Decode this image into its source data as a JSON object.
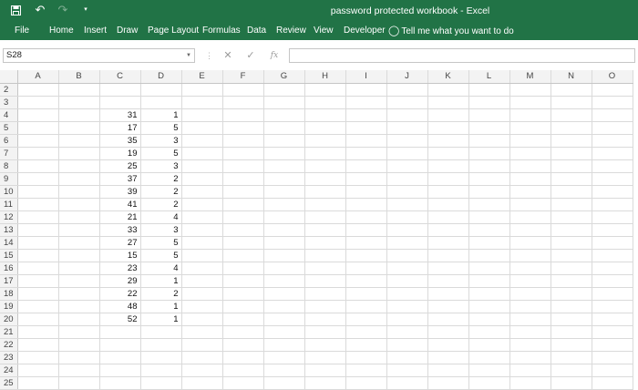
{
  "titlebar": {
    "title": "password protected workbook  -  Excel",
    "save_icon": "save-icon",
    "undo_icon": "undo-icon",
    "redo_icon": "redo-icon",
    "customize_icon": "customize-qat-icon"
  },
  "ribbon": {
    "tabs": [
      "File",
      "Home",
      "Insert",
      "Draw",
      "Page Layout",
      "Formulas",
      "Data",
      "Review",
      "View",
      "Developer"
    ],
    "tell_me": "Tell me what you want to do",
    "tell_me_icon": "lightbulb-icon"
  },
  "formula_bar": {
    "name_box": "S28",
    "formula": "",
    "fx_label": "fx"
  },
  "grid": {
    "columns": [
      "A",
      "B",
      "C",
      "D",
      "E",
      "F",
      "G",
      "H",
      "I",
      "J",
      "K",
      "L",
      "M",
      "N",
      "O"
    ],
    "rows": [
      {
        "num": "2",
        "c": "",
        "d": ""
      },
      {
        "num": "3",
        "c": "",
        "d": ""
      },
      {
        "num": "4",
        "c": "31",
        "d": "1"
      },
      {
        "num": "5",
        "c": "17",
        "d": "5"
      },
      {
        "num": "6",
        "c": "35",
        "d": "3"
      },
      {
        "num": "7",
        "c": "19",
        "d": "5"
      },
      {
        "num": "8",
        "c": "25",
        "d": "3"
      },
      {
        "num": "9",
        "c": "37",
        "d": "2"
      },
      {
        "num": "10",
        "c": "39",
        "d": "2"
      },
      {
        "num": "11",
        "c": "41",
        "d": "2"
      },
      {
        "num": "12",
        "c": "21",
        "d": "4"
      },
      {
        "num": "13",
        "c": "33",
        "d": "3"
      },
      {
        "num": "14",
        "c": "27",
        "d": "5"
      },
      {
        "num": "15",
        "c": "15",
        "d": "5"
      },
      {
        "num": "16",
        "c": "23",
        "d": "4"
      },
      {
        "num": "17",
        "c": "29",
        "d": "1"
      },
      {
        "num": "18",
        "c": "22",
        "d": "2"
      },
      {
        "num": "19",
        "c": "48",
        "d": "1"
      },
      {
        "num": "20",
        "c": "52",
        "d": "1"
      },
      {
        "num": "21",
        "c": "",
        "d": ""
      },
      {
        "num": "22",
        "c": "",
        "d": ""
      },
      {
        "num": "23",
        "c": "",
        "d": ""
      },
      {
        "num": "24",
        "c": "",
        "d": ""
      },
      {
        "num": "25",
        "c": "",
        "d": ""
      }
    ]
  }
}
